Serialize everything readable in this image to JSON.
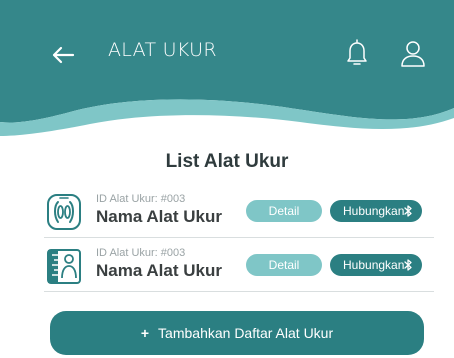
{
  "header": {
    "title": "ALAT UKUR",
    "colors": {
      "primary": "#35878a",
      "wave_light": "#7fc6c7"
    }
  },
  "icons": {
    "back": "arrow-left-icon",
    "notification": "bell-icon",
    "profile": "user-icon",
    "bluetooth": "bluetooth-icon"
  },
  "list": {
    "title": "List Alat Ukur",
    "items": [
      {
        "id_label": "ID Alat Ukur: #003",
        "name": "Nama Alat Ukur",
        "icon": "body-scale-icon",
        "detail_label": "Detail",
        "connect_label": "Hubungkan"
      },
      {
        "id_label": "ID Alat Ukur: #003",
        "name": "Nama Alat Ukur",
        "icon": "height-scale-icon",
        "detail_label": "Detail",
        "connect_label": "Hubungkan"
      }
    ]
  },
  "add_button": {
    "plus": "+",
    "label": "Tambahkan Daftar Alat Ukur"
  }
}
